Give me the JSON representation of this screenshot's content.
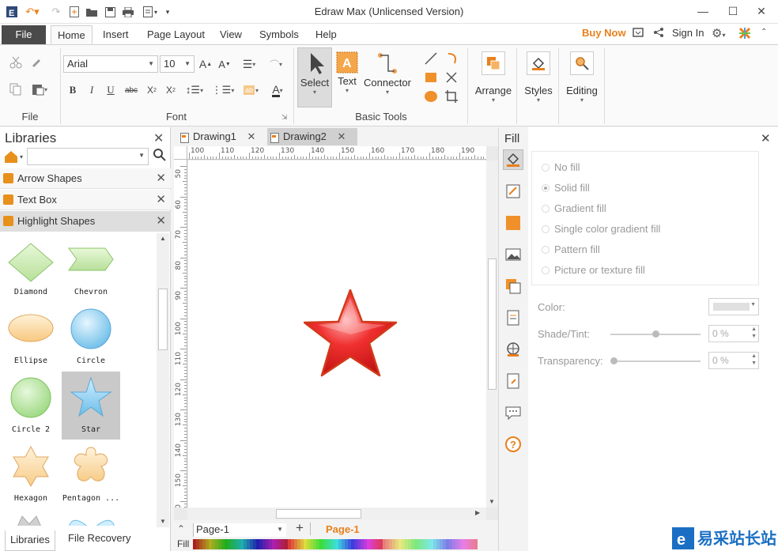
{
  "window": {
    "title": "Edraw Max (Unlicensed Version)"
  },
  "menu": {
    "file": "File",
    "tabs": [
      "Home",
      "Insert",
      "Page Layout",
      "View",
      "Symbols",
      "Help"
    ],
    "buy_now": "Buy Now",
    "sign_in": "Sign In"
  },
  "ribbon": {
    "font_name": "Arial",
    "font_size": "10",
    "group_file": "File",
    "group_font": "Font",
    "group_basic_tools": "Basic Tools",
    "select": "Select",
    "text": "Text",
    "connector": "Connector",
    "arrange": "Arrange",
    "styles": "Styles",
    "editing": "Editing"
  },
  "libraries": {
    "title": "Libraries",
    "rows": [
      "Arrow Shapes",
      "Text Box",
      "Highlight Shapes"
    ],
    "shapes": [
      "Diamond",
      "Chevron",
      "Ellipse",
      "Circle",
      "Circle 2",
      "Star",
      "Hexagon",
      "Pentagon ..."
    ],
    "bottom_tabs": [
      "Libraries",
      "File Recovery"
    ]
  },
  "documents": {
    "tabs": [
      "Drawing1",
      "Drawing2"
    ]
  },
  "rulers": {
    "h": [
      "100",
      "110",
      "120",
      "130",
      "140",
      "150",
      "160",
      "170",
      "180",
      "190"
    ],
    "v": [
      "50",
      "60",
      "70",
      "80",
      "90",
      "100",
      "110",
      "120",
      "130",
      "140",
      "150",
      "160"
    ]
  },
  "pages": {
    "selector": "Page-1",
    "active": "Page-1",
    "fill_label": "Fill"
  },
  "fill": {
    "title": "Fill",
    "options": [
      "No fill",
      "Solid fill",
      "Gradient fill",
      "Single color gradient fill",
      "Pattern fill",
      "Picture or texture fill"
    ],
    "selected": "Solid fill",
    "color_label": "Color:",
    "shade_label": "Shade/Tint:",
    "shade_value": "0 %",
    "transparency_label": "Transparency:",
    "transparency_value": "0 %"
  },
  "watermark": {
    "text": "易采站长站"
  },
  "colors": {
    "accent": "#e8801c",
    "star_red": "#e52020"
  }
}
